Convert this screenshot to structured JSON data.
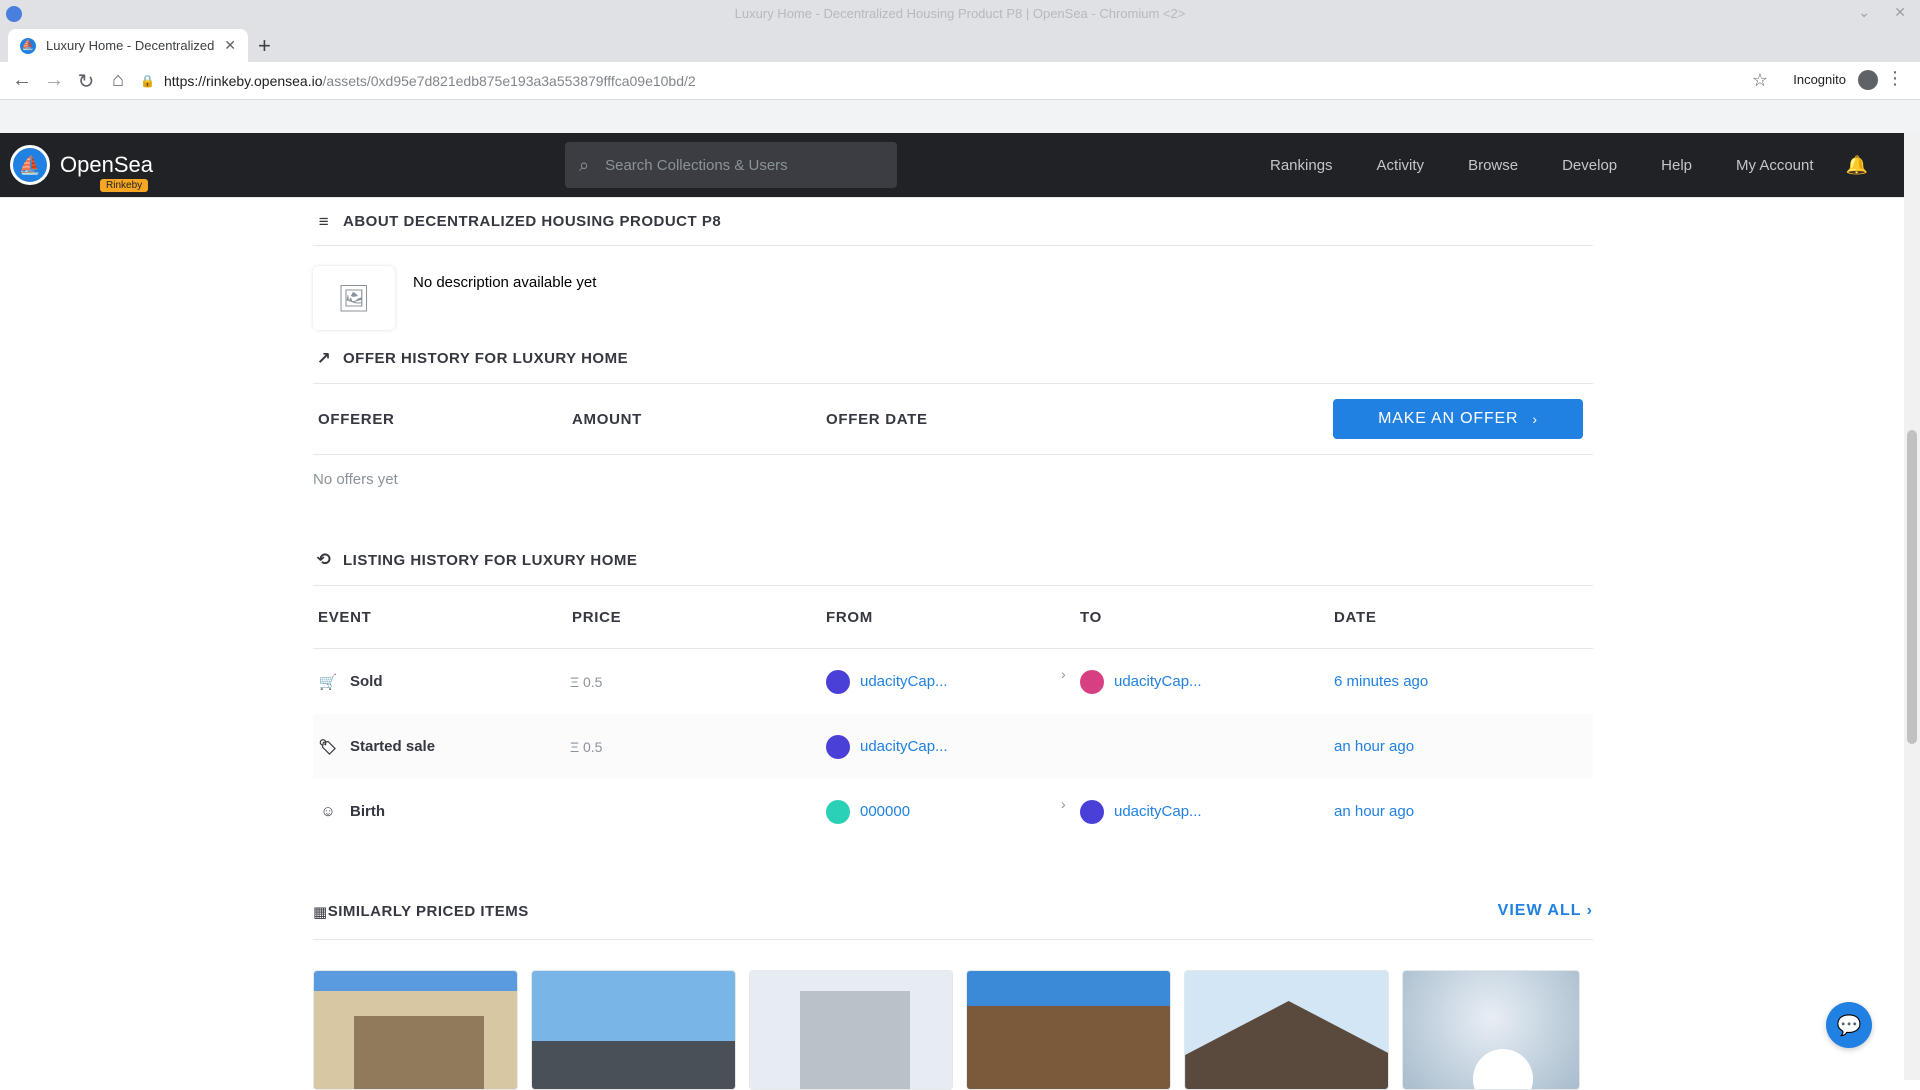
{
  "browser": {
    "window_title": "Luxury Home - Decentralized Housing Product P8 | OpenSea - Chromium <2>",
    "tab_title": "Luxury Home - Decentralized",
    "url_host": "https://rinkeby.opensea.io",
    "url_path": "/assets/0xd95e7d821edb875e193a3a553879fffca09e10bd/2",
    "incognito_label": "Incognito"
  },
  "nav": {
    "brand": "OpenSea",
    "network_badge": "Rinkeby",
    "search_placeholder": "Search Collections & Users",
    "links": [
      "Rankings",
      "Activity",
      "Browse",
      "Develop",
      "Help",
      "My Account"
    ]
  },
  "about": {
    "title": "ABOUT DECENTRALIZED HOUSING PRODUCT P8",
    "description": "No description available yet"
  },
  "offers": {
    "title": "OFFER HISTORY FOR LUXURY HOME",
    "columns": [
      "OFFERER",
      "AMOUNT",
      "OFFER DATE"
    ],
    "make_offer_label": "MAKE AN OFFER",
    "empty_text": "No offers yet"
  },
  "listing": {
    "title": "LISTING HISTORY FOR LUXURY HOME",
    "columns": [
      "EVENT",
      "PRICE",
      "FROM",
      "TO",
      "DATE"
    ],
    "rows": [
      {
        "event": "Sold",
        "icon": "cart-icon",
        "price": "Ξ 0.5",
        "from": "udacityCap...",
        "from_color": "#4a3fd6",
        "to": "udacityCap...",
        "to_color": "#d63f82",
        "date": "6 minutes ago"
      },
      {
        "event": "Started sale",
        "icon": "tag-icon",
        "price": "Ξ 0.5",
        "from": "udacityCap...",
        "from_color": "#4a3fd6",
        "to": "",
        "to_color": "",
        "date": "an hour ago"
      },
      {
        "event": "Birth",
        "icon": "smiley-icon",
        "price": "",
        "from": "000000",
        "from_color": "#2ad1b6",
        "to": "udacityCap...",
        "to_color": "#4a3fd6",
        "date": "an hour ago"
      }
    ]
  },
  "similar": {
    "title": "SIMILARLY PRICED ITEMS",
    "view_all_label": "VIEW ALL"
  }
}
